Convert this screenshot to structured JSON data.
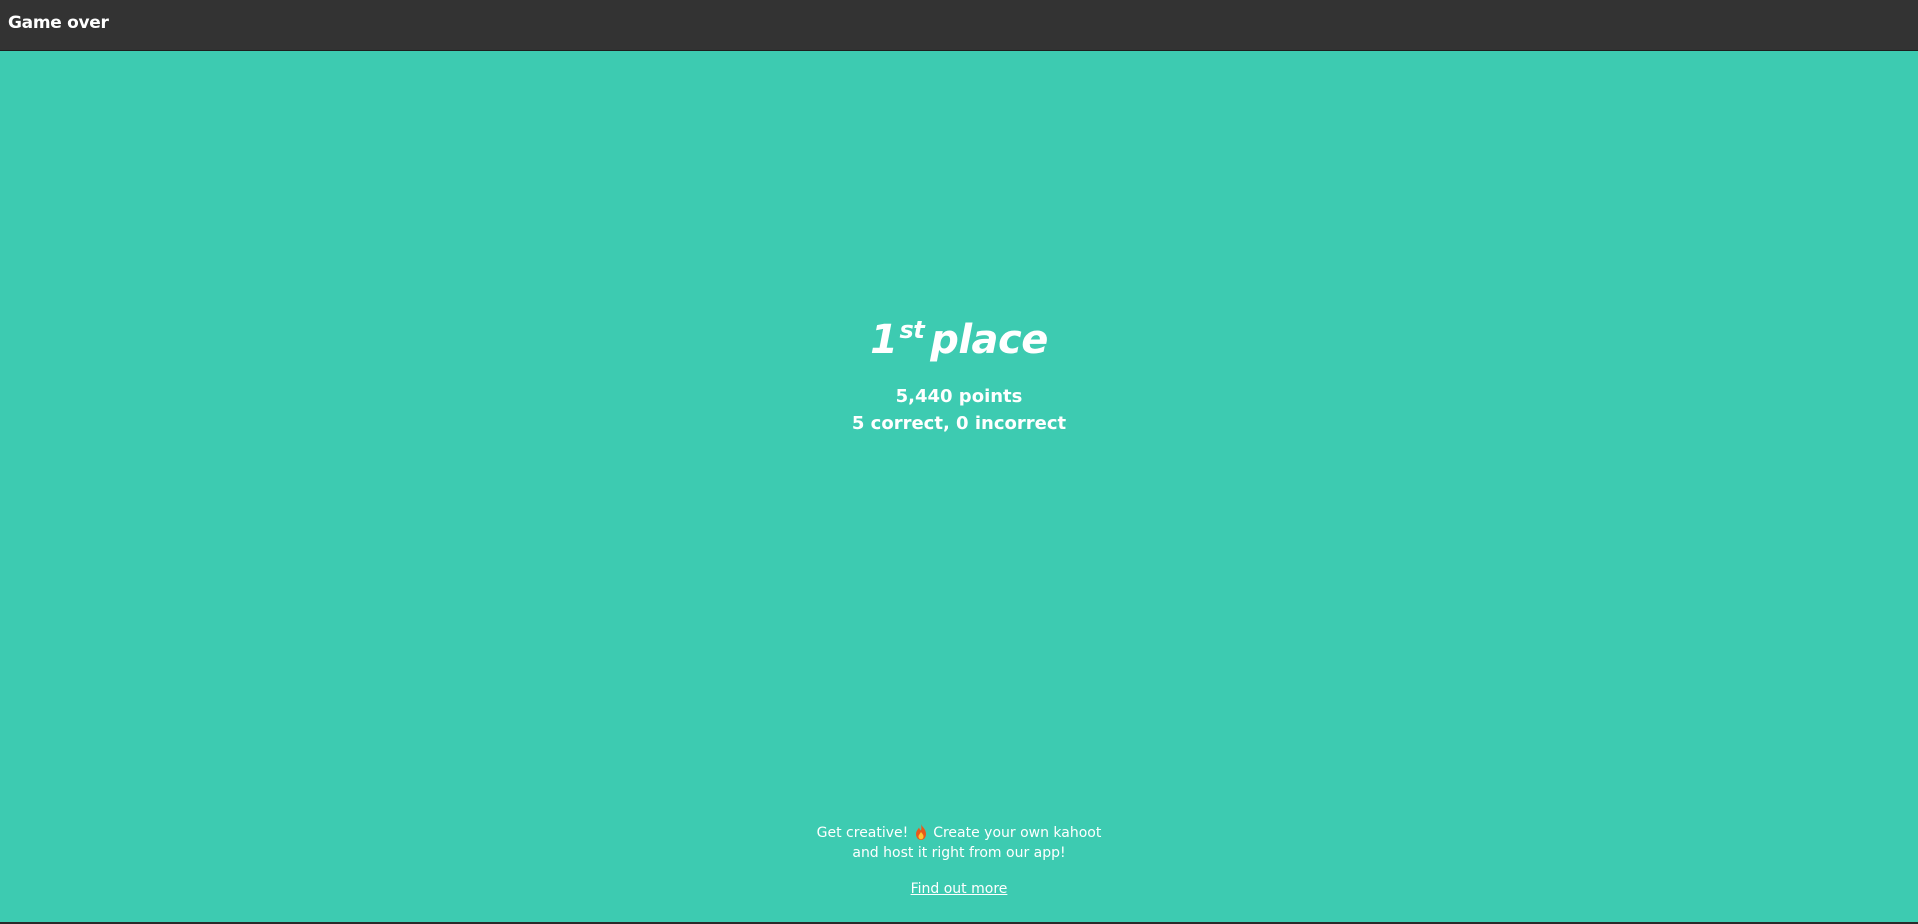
{
  "header": {
    "title": "Game over"
  },
  "result": {
    "place_number": "1",
    "place_suffix": "st",
    "place_word": "place",
    "points": "5,440 points",
    "answers": "5 correct, 0 incorrect"
  },
  "promo": {
    "line1_before_icon": "Get creative!",
    "icon": "fire-icon",
    "line1_after_icon": "Create your own kahoot",
    "line2": "and host it right from our app!",
    "link_label": "Find out more"
  },
  "colors": {
    "background": "#3dcbb1",
    "topbar": "#333333",
    "text": "#ffffff"
  }
}
